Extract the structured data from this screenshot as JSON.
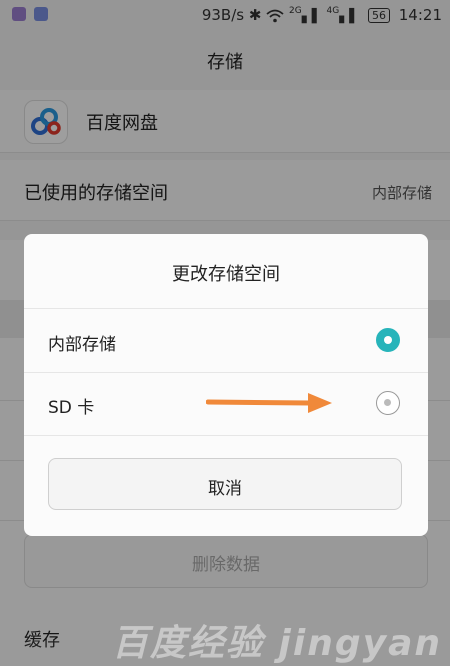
{
  "status_bar": {
    "speed": "93B/s",
    "net_2g": "2G",
    "net_4g": "4G",
    "battery": "56",
    "time": "14:21"
  },
  "header": {
    "title": "存储"
  },
  "app": {
    "name": "百度网盘",
    "icon": "baidu-netdisk-icon"
  },
  "storage": {
    "used_label": "已使用的存储空间",
    "location_value": "内部存储"
  },
  "background": {
    "delete_button": "删除数据",
    "cache_label": "缓存"
  },
  "dialog": {
    "title": "更改存储空间",
    "options": [
      {
        "label": "内部存储",
        "selected": true
      },
      {
        "label": "SD 卡",
        "selected": false
      }
    ],
    "cancel": "取消"
  },
  "colors": {
    "accent": "#27b4ba",
    "annotation_arrow": "#f0893a"
  }
}
